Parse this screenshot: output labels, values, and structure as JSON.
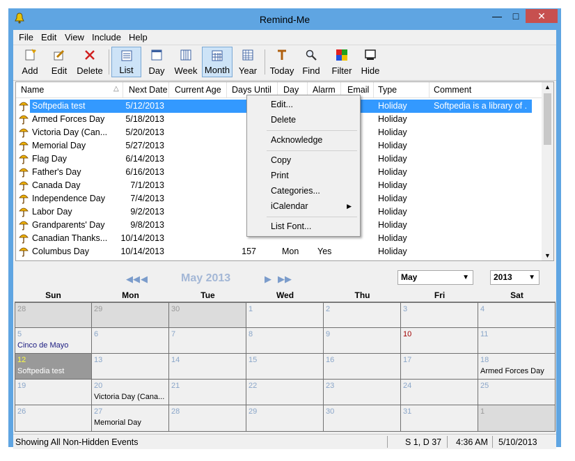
{
  "window": {
    "title": "Remind-Me"
  },
  "menu": [
    "File",
    "Edit",
    "View",
    "Include",
    "Help"
  ],
  "toolbar": [
    {
      "label": "Add",
      "icon": "add-icon"
    },
    {
      "label": "Edit",
      "icon": "edit-icon"
    },
    {
      "label": "Delete",
      "icon": "delete-icon"
    },
    {
      "label": "List",
      "icon": "list-view-icon",
      "active": true
    },
    {
      "label": "Day",
      "icon": "day-view-icon"
    },
    {
      "label": "Week",
      "icon": "week-view-icon"
    },
    {
      "label": "Month",
      "icon": "month-view-icon",
      "active": true
    },
    {
      "label": "Year",
      "icon": "year-view-icon"
    },
    {
      "label": "Today",
      "icon": "today-icon"
    },
    {
      "label": "Find",
      "icon": "find-icon"
    },
    {
      "label": "Filter",
      "icon": "filter-icon"
    },
    {
      "label": "Hide",
      "icon": "hide-icon"
    }
  ],
  "list": {
    "columns": [
      "Name",
      "Next Date",
      "Current Age",
      "Days Until",
      "Day",
      "Alarm",
      "Email",
      "Type",
      "Comment"
    ],
    "rows": [
      {
        "name": "Softpedia test",
        "date": "5/12/2013",
        "days": "",
        "day": "",
        "alarm": "",
        "type": "Holiday",
        "comment": "Softpedia is a library of ..."
      },
      {
        "name": "Armed Forces Day",
        "date": "5/18/2013",
        "days": "",
        "day": "",
        "alarm": "",
        "type": "Holiday",
        "comment": ""
      },
      {
        "name": "Victoria Day (Can...",
        "date": "5/20/2013",
        "days": "",
        "day": "",
        "alarm": "",
        "type": "Holiday",
        "comment": ""
      },
      {
        "name": "Memorial Day",
        "date": "5/27/2013",
        "days": "",
        "day": "",
        "alarm": "",
        "type": "Holiday",
        "comment": ""
      },
      {
        "name": "Flag Day",
        "date": "6/14/2013",
        "days": "",
        "day": "",
        "alarm": "",
        "type": "Holiday",
        "comment": ""
      },
      {
        "name": "Father's Day",
        "date": "6/16/2013",
        "days": "",
        "day": "",
        "alarm": "",
        "type": "Holiday",
        "comment": ""
      },
      {
        "name": "Canada Day",
        "date": "7/1/2013",
        "days": "",
        "day": "",
        "alarm": "",
        "type": "Holiday",
        "comment": ""
      },
      {
        "name": "Independence Day",
        "date": "7/4/2013",
        "days": "",
        "day": "",
        "alarm": "",
        "type": "Holiday",
        "comment": ""
      },
      {
        "name": "Labor Day",
        "date": "9/2/2013",
        "days": "",
        "day": "",
        "alarm": "",
        "type": "Holiday",
        "comment": ""
      },
      {
        "name": "Grandparents' Day",
        "date": "9/8/2013",
        "days": "",
        "day": "",
        "alarm": "",
        "type": "Holiday",
        "comment": ""
      },
      {
        "name": "Canadian Thanks...",
        "date": "10/14/2013",
        "days": "",
        "day": "",
        "alarm": "",
        "type": "Holiday",
        "comment": ""
      },
      {
        "name": "Columbus Day",
        "date": "10/14/2013",
        "days": "157",
        "day": "Mon",
        "alarm": "Yes",
        "type": "Holiday",
        "comment": ""
      }
    ]
  },
  "context_menu": [
    "Edit...",
    "Delete",
    "Acknowledge",
    "Copy",
    "Print",
    "Categories...",
    "iCalendar",
    "List Font..."
  ],
  "calendar": {
    "title": "May 2013",
    "month_select": "May",
    "year_select": "2013",
    "days_of_week": [
      "Sun",
      "Mon",
      "Tue",
      "Wed",
      "Thu",
      "Fri",
      "Sat"
    ],
    "weeks": [
      [
        {
          "n": "28",
          "other": true
        },
        {
          "n": "29",
          "other": true
        },
        {
          "n": "30",
          "other": true
        },
        {
          "n": "1"
        },
        {
          "n": "2"
        },
        {
          "n": "3"
        },
        {
          "n": "4"
        }
      ],
      [
        {
          "n": "5",
          "ev": "Cinco de Mayo"
        },
        {
          "n": "6"
        },
        {
          "n": "7"
        },
        {
          "n": "8"
        },
        {
          "n": "9"
        },
        {
          "n": "10",
          "red": true
        },
        {
          "n": "11"
        }
      ],
      [
        {
          "n": "12",
          "ev": "Softpedia test",
          "today": true
        },
        {
          "n": "13"
        },
        {
          "n": "14"
        },
        {
          "n": "15"
        },
        {
          "n": "16"
        },
        {
          "n": "17"
        },
        {
          "n": "18",
          "ev": "Armed Forces Day"
        }
      ],
      [
        {
          "n": "19"
        },
        {
          "n": "20",
          "ev": "Victoria Day (Cana..."
        },
        {
          "n": "21"
        },
        {
          "n": "22"
        },
        {
          "n": "23"
        },
        {
          "n": "24"
        },
        {
          "n": "25"
        }
      ],
      [
        {
          "n": "26"
        },
        {
          "n": "27",
          "ev": "Memorial Day"
        },
        {
          "n": "28"
        },
        {
          "n": "29"
        },
        {
          "n": "30"
        },
        {
          "n": "31"
        },
        {
          "n": "1",
          "other": true
        }
      ]
    ]
  },
  "status": {
    "message": "Showing All Non-Hidden Events",
    "selection": "S 1, D 37",
    "time": "4:36 AM",
    "date": "5/10/2013"
  }
}
